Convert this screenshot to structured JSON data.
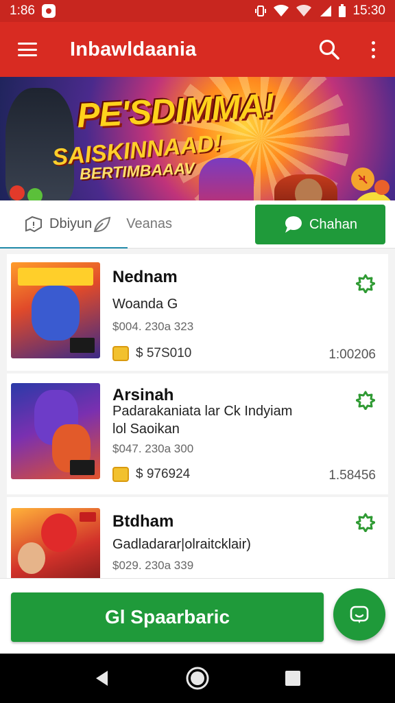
{
  "status_bar": {
    "time_left": "1:86",
    "time_right": "15:30"
  },
  "app_bar": {
    "title": "Inbawldaania",
    "icons": [
      "menu-icon",
      "search-icon",
      "more-vert-icon"
    ]
  },
  "banner": {
    "headline": "PE'SDIMMA!",
    "line2": "SAISKINNAAD!",
    "line3": "BERTIMBAAAV"
  },
  "tabs": {
    "items": [
      {
        "label": "Dbiyun",
        "icon": "chat-outline-icon",
        "active": true
      },
      {
        "label": "Veanas",
        "icon": "leaf-icon",
        "active": false
      }
    ],
    "chat_button": {
      "label": "Chahan",
      "icon": "chat-bubble-icon"
    }
  },
  "list": {
    "items": [
      {
        "name": "Nednam",
        "subtitle": "Woanda G",
        "meta": "$004. 230a 323",
        "price": "$ 57S010",
        "total": "1:00206"
      },
      {
        "name": "Arsinah",
        "subtitle": "Padarakaniata lar Ck Indyiam",
        "subtitle2": "lol Saoikan",
        "meta": "$047. 230a 300",
        "price": "$ 976924",
        "total": "1.58456"
      },
      {
        "name": "Btdham",
        "subtitle": "Gadladarar|olraitcklair)",
        "meta": "$029. 230a 339",
        "price": "",
        "total": ""
      }
    ]
  },
  "bottom": {
    "primary_button": "Gl Spaarbaric",
    "fab_icon": "chat-smile-icon"
  },
  "nav_bar": {
    "icons": [
      "back-icon",
      "home-icon",
      "recents-icon"
    ]
  },
  "colors": {
    "app_bar": "#d82b22",
    "status_bar": "#c8261f",
    "accent_green": "#1f9a3a",
    "tab_indicator": "#1e88a8"
  }
}
